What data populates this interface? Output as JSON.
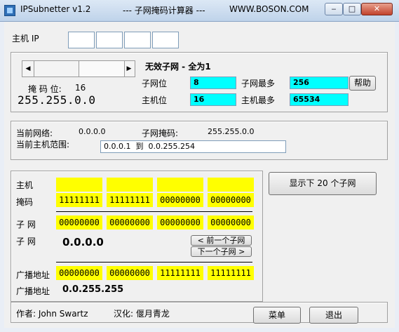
{
  "window": {
    "app_name": "IPSubnetter v1.2",
    "subtitle": "--- 子网掩码计算器 ---",
    "website": "WWW.BOSON.COM"
  },
  "host_ip": {
    "label": "主机 IP",
    "octets": [
      "",
      "",
      "",
      ""
    ]
  },
  "mask_panel": {
    "mask_bits_label": "掩 码 位:",
    "mask_bits_value": "16",
    "mask_value": "255.255.0.0",
    "status": "无效子网 - 全为1",
    "subnet_bits_label": "子网位",
    "subnet_bits_value": "8",
    "max_subnets_label": "子网最多",
    "max_subnets_value": "256",
    "host_bits_label": "主机位",
    "host_bits_value": "16",
    "max_hosts_label": "主机最多",
    "max_hosts_value": "65534",
    "help_label": "帮助"
  },
  "network_info": {
    "current_network_label": "当前网络:",
    "current_network_value": "0.0.0.0",
    "subnet_mask_label": "子网掩码:",
    "subnet_mask_value": "255.255.0.0",
    "host_range_label": "当前主机范围:",
    "host_range_value": "0.0.0.1  到  0.0.255.254"
  },
  "binary": {
    "host_label": "主机",
    "host_bits": [
      "",
      "",
      "",
      ""
    ],
    "mask_label": "掩码",
    "mask_bits": [
      "11111111",
      "11111111",
      "00000000",
      "00000000"
    ],
    "subnet_label": "子 网",
    "subnet_bits": [
      "00000000",
      "00000000",
      "00000000",
      "00000000"
    ],
    "subnet_label2": "子 网",
    "subnet_address": "0.0.0.0",
    "prev_subnet_label": "< 前一个子网",
    "next_subnet_label": "下一个子网 >",
    "broadcast_label": "广播地址",
    "broadcast_bits": [
      "00000000",
      "00000000",
      "11111111",
      "11111111"
    ],
    "broadcast_label2": "广播地址",
    "broadcast_address": "0.0.255.255"
  },
  "show_next_label": "显示下 20 个子网",
  "footer": {
    "author": "作者: John Swartz",
    "localizer": "汉化: 偃月青龙",
    "menu_label": "菜单",
    "exit_label": "退出"
  },
  "colors": {
    "highlight_cyan": "#00ffff",
    "highlight_yellow": "#ffff00"
  }
}
